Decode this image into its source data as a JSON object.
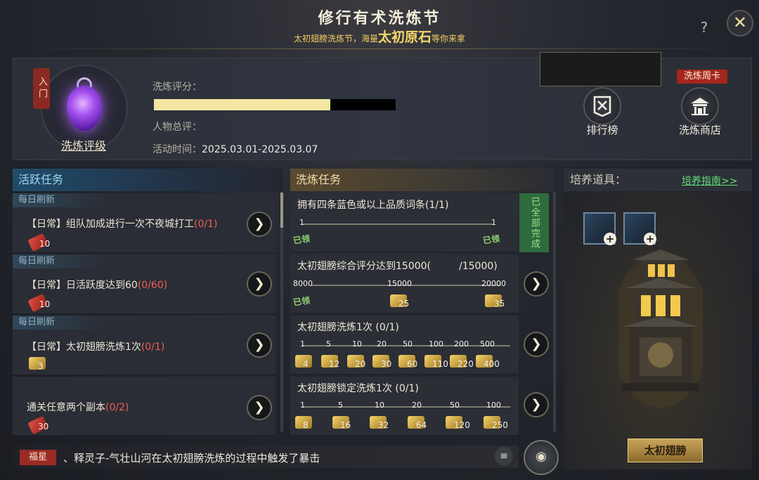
{
  "header": {
    "title": "修行有术洗炼节",
    "subtitle_prefix": "太初翅膀洗炼节，海量",
    "subtitle_highlight": "太初原石",
    "subtitle_suffix": "等你来拿",
    "help_glyph": "?",
    "close_glyph": "✕"
  },
  "profile": {
    "rank_tag": "入门",
    "grade_link": "洗炼评级",
    "score_label": "洗炼评分：",
    "score_progress": 0.73,
    "overall_label": "人物总评：",
    "time_label": "活动时间：",
    "time_value": "2025.03.01-2025.03.07"
  },
  "top_buttons": {
    "ranking": "排行榜",
    "weekcard_tag": "洗炼周卡",
    "shop": "洗炼商店"
  },
  "active_tasks": {
    "header": "活跃任务",
    "items": [
      {
        "refresh": "每日刷新",
        "text": "【日常】组队加成进行一次不夜城打工",
        "progress": "(0/1)",
        "reward": "10"
      },
      {
        "refresh": "每日刷新",
        "text": "【日常】日活跃度达到60",
        "progress": "(0/60)",
        "reward": "10"
      },
      {
        "refresh": "每日刷新",
        "text": "【日常】太初翅膀洗炼1次",
        "progress": "(0/1)",
        "reward": "3"
      },
      {
        "refresh": "",
        "text": "通关任意两个副本",
        "progress": "(0/2)",
        "reward": "30"
      }
    ],
    "arrow": "❯"
  },
  "refine_tasks": {
    "header": "洗炼任务",
    "done_badge": "已全部完成",
    "claimed": "已领",
    "t1": {
      "title": "拥有四条蓝色或以上品质词条(1/1)",
      "ticks": [
        "1",
        "1"
      ]
    },
    "t2": {
      "title": "太初翅膀综合评分达到15000(",
      "title_end": "/15000)",
      "ticks": [
        "8000",
        "15000",
        "20000"
      ],
      "rewards": [
        "25",
        "35"
      ]
    },
    "t3": {
      "title": "太初翅膀洗炼1次 (0/1)",
      "ticks": [
        "1",
        "5",
        "10",
        "20",
        "50",
        "100",
        "200",
        "500"
      ],
      "rewards": [
        "4",
        "12",
        "20",
        "30",
        "60",
        "110",
        "220",
        "400"
      ]
    },
    "t4": {
      "title": "太初翅膀锁定洗炼1次 (0/1)",
      "ticks": [
        "1",
        "5",
        "10",
        "20",
        "50",
        "100"
      ],
      "rewards": [
        "8",
        "16",
        "32",
        "64",
        "120",
        "250"
      ]
    }
  },
  "cultivation": {
    "header": "培养道具：",
    "guide": "培养指南>>",
    "plus": "+",
    "wings_button": "太初翅膀"
  },
  "ticker": {
    "tag": "福星",
    "text": "、释灵子-气壮山河在太初翅膀洗炼的过程中触发了暴击",
    "list_glyph": "≡",
    "chat_glyph": "◉"
  }
}
